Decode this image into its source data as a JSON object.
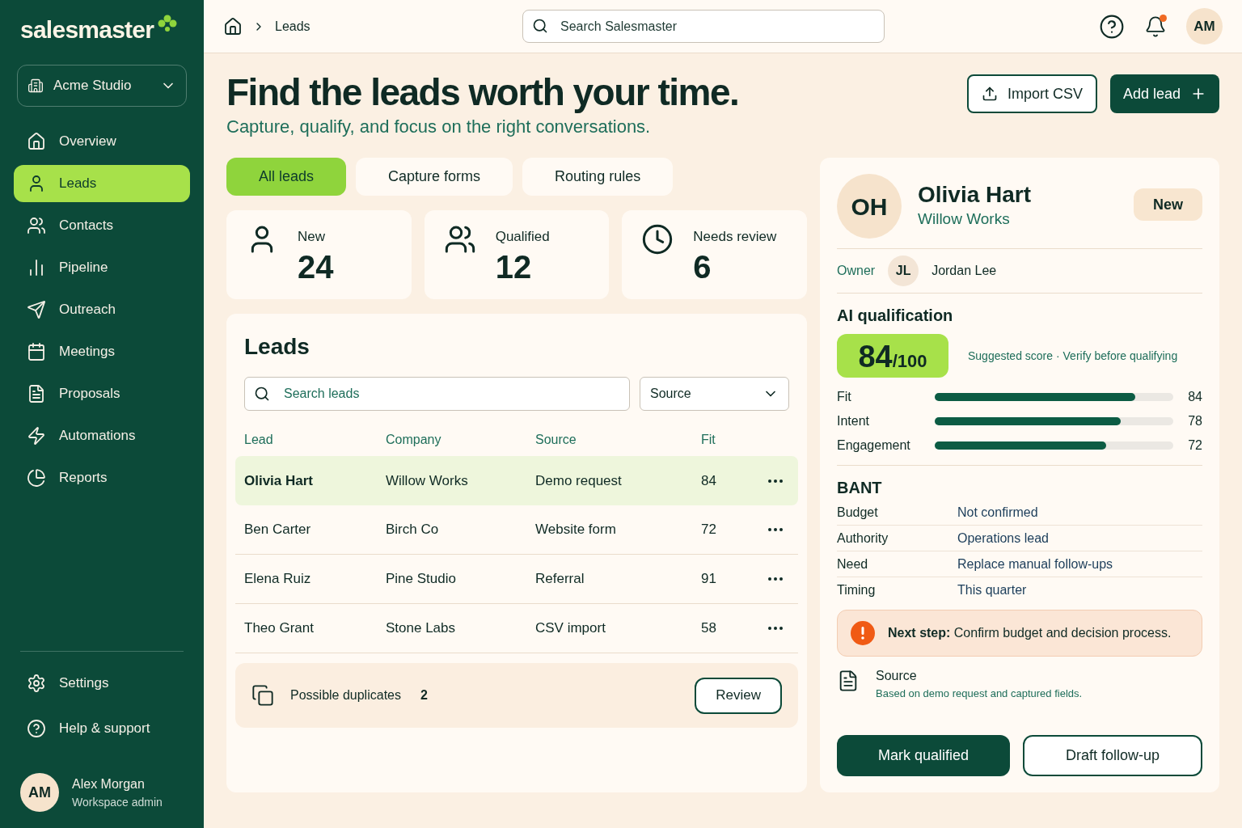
{
  "brand": {
    "name": "salesmaster"
  },
  "workspace": {
    "name": "Acme Studio"
  },
  "nav": [
    {
      "label": "Overview",
      "selected": false
    },
    {
      "label": "Leads",
      "selected": true
    },
    {
      "label": "Contacts",
      "selected": false
    },
    {
      "label": "Pipeline",
      "selected": false
    },
    {
      "label": "Outreach",
      "selected": false
    },
    {
      "label": "Meetings",
      "selected": false
    },
    {
      "label": "Proposals",
      "selected": false
    },
    {
      "label": "Automations",
      "selected": false
    },
    {
      "label": "Reports",
      "selected": false
    }
  ],
  "footer_nav": [
    {
      "label": "Settings"
    },
    {
      "label": "Help & support"
    }
  ],
  "user": {
    "initials": "AM",
    "name": "Alex Morgan",
    "role": "Workspace admin"
  },
  "breadcrumb": [
    "Leads"
  ],
  "search": {
    "placeholder": "Search Salesmaster"
  },
  "header": {
    "avatar": "AM",
    "unread": true
  },
  "page": {
    "title": "Find the leads worth your time.",
    "subtitle": "Capture, qualify, and focus on the right conversations.",
    "actions": [
      {
        "label": "Import CSV",
        "kind": "outline"
      },
      {
        "label": "Add lead",
        "kind": "primary"
      }
    ]
  },
  "tabs": [
    {
      "label": "All leads",
      "selected": true
    },
    {
      "label": "Capture forms",
      "selected": false
    },
    {
      "label": "Routing rules",
      "selected": false
    }
  ],
  "stats": [
    {
      "label": "New",
      "value": "24"
    },
    {
      "label": "Qualified",
      "value": "12"
    },
    {
      "label": "Needs review",
      "value": "6"
    }
  ],
  "leads": {
    "title": "Leads",
    "search_placeholder": "Search leads",
    "filter": "Source",
    "columns": [
      "Lead",
      "Company",
      "Source",
      "Fit"
    ],
    "rows": [
      {
        "lead": "Olivia Hart",
        "company": "Willow Works",
        "source": "Demo request",
        "fit": "84",
        "selected": true
      },
      {
        "lead": "Ben Carter",
        "company": "Birch Co",
        "source": "Website form",
        "fit": "72",
        "selected": false
      },
      {
        "lead": "Elena Ruiz",
        "company": "Pine Studio",
        "source": "Referral",
        "fit": "91",
        "selected": false
      },
      {
        "lead": "Theo Grant",
        "company": "Stone Labs",
        "source": "CSV import",
        "fit": "58",
        "selected": false
      }
    ],
    "duplicates": {
      "label": "Possible duplicates",
      "count": "2",
      "action": "Review"
    }
  },
  "detail": {
    "initials": "OH",
    "name": "Olivia Hart",
    "company": "Willow Works",
    "status": "New",
    "owner_label": "Owner",
    "owner_initials": "JL",
    "owner_name": "Jordan Lee",
    "ai_title": "AI qualification",
    "score": "84",
    "score_max": "/100",
    "score_note": "Suggested score",
    "separator": "·",
    "score_hint": "Verify before qualifying",
    "metrics": [
      {
        "label": "Fit",
        "level": 0.84,
        "value": "84"
      },
      {
        "label": "Intent",
        "level": 0.78,
        "value": "78"
      },
      {
        "label": "Engagement",
        "level": 0.72,
        "value": "72"
      }
    ],
    "bant_title": "BANT",
    "bant": [
      {
        "label": "Budget",
        "value": "Not confirmed"
      },
      {
        "label": "Authority",
        "value": "Operations lead"
      },
      {
        "label": "Need",
        "value": "Replace manual follow-ups"
      },
      {
        "label": "Timing",
        "value": "This quarter"
      }
    ],
    "next_step": "**Next step:** Confirm budget and decision process.",
    "source_title": "Source",
    "source_text": "Based on demo request and captured fields.",
    "actions": [
      {
        "label": "Mark qualified",
        "kind": "primary"
      },
      {
        "label": "Draft follow-up",
        "kind": "outline"
      }
    ]
  }
}
